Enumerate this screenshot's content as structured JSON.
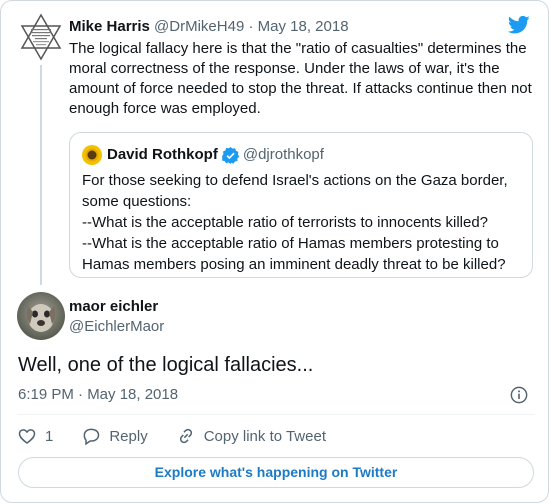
{
  "parent_tweet": {
    "author_name": "Mike Harris",
    "handle": "@DrMikeH49",
    "separator": "·",
    "date": "May 18, 2018",
    "avatar_icon": "star-of-david-avatar",
    "text": "The logical fallacy here is that the \"ratio of casualties\" determines the moral correctness of the response. Under the laws of war, it's the amount of force needed to stop the threat. If attacks continue then not enough force was employed."
  },
  "quoted_tweet": {
    "author_name": "David Rothkopf",
    "handle": "@djrothkopf",
    "avatar_icon": "sunflower-avatar",
    "verified_icon": "verified-badge-icon",
    "lines": [
      "For those seeking to defend Israel's actions on the Gaza border,",
      "some questions:",
      "--What is the acceptable ratio of terrorists to innocents killed?",
      "--What is the acceptable ratio of Hamas members protesting to",
      "Hamas members posing an imminent deadly threat to be killed?"
    ]
  },
  "main_tweet": {
    "author_name": "maor eichler",
    "handle": "@EichlerMaor",
    "avatar_icon": "dog-photo-avatar",
    "text": "Well, one of the logical fallacies...",
    "timestamp": "6:19 PM · May 18, 2018",
    "info_icon": "info-icon"
  },
  "actions": {
    "like_count": "1",
    "reply_label": "Reply",
    "copy_link_label": "Copy link to Tweet"
  },
  "footer": {
    "explore_label": "Explore what's happening on Twitter"
  },
  "colors": {
    "twitter_blue": "#1d9bf0",
    "link_blue": "#1d7bc4",
    "muted_text": "#536471",
    "border": "#cfd9de"
  }
}
